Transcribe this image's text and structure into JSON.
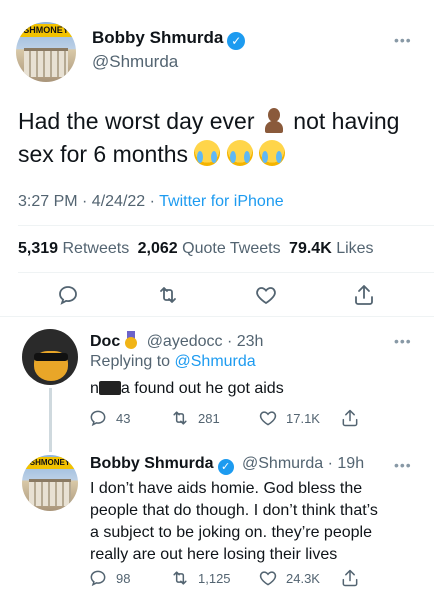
{
  "main_tweet": {
    "avatar_banner": "SHMONEY",
    "display_name": "Bobby Shmurda",
    "handle": "@Shmurda",
    "text_part1": "Had the worst day ever",
    "text_part2": "not having",
    "text_part3": "sex for 6 months",
    "time": "3:27 PM · 4/24/22 ·",
    "source": "Twitter for iPhone",
    "retweets_count": "5,319",
    "retweets_label": "Retweets",
    "quotes_count": "2,062",
    "quotes_label": "Quote Tweets",
    "likes_count": "79.4K",
    "likes_label": "Likes"
  },
  "reply1": {
    "display_name": "Doc",
    "handle_time": "@ayedocc · 23h",
    "replying_label": "Replying to",
    "replying_handle": "@Shmurda",
    "text": "a found out he got aids",
    "text_prefix": "n",
    "replies": "43",
    "retweets": "281",
    "likes": "17.1K"
  },
  "reply2": {
    "avatar_banner": "SHMONEY",
    "display_name": "Bobby Shmurda",
    "handle_time": "@Shmurda · 19h",
    "line1": "I don’t have aids homie. God bless the",
    "line2": "people that do though. I don’t think that’s",
    "line3": "a subject to be joking on. they’re people",
    "line4": "really are out here losing their lives",
    "replies": "98",
    "retweets": "1,125",
    "likes": "24.3K"
  },
  "icons": [
    "reply-icon",
    "retweet-icon",
    "like-icon",
    "share-icon",
    "verified-icon",
    "more-icon"
  ],
  "colors": {
    "accent": "#1d9bf0",
    "text": "#0f1419",
    "muted": "#536471"
  }
}
